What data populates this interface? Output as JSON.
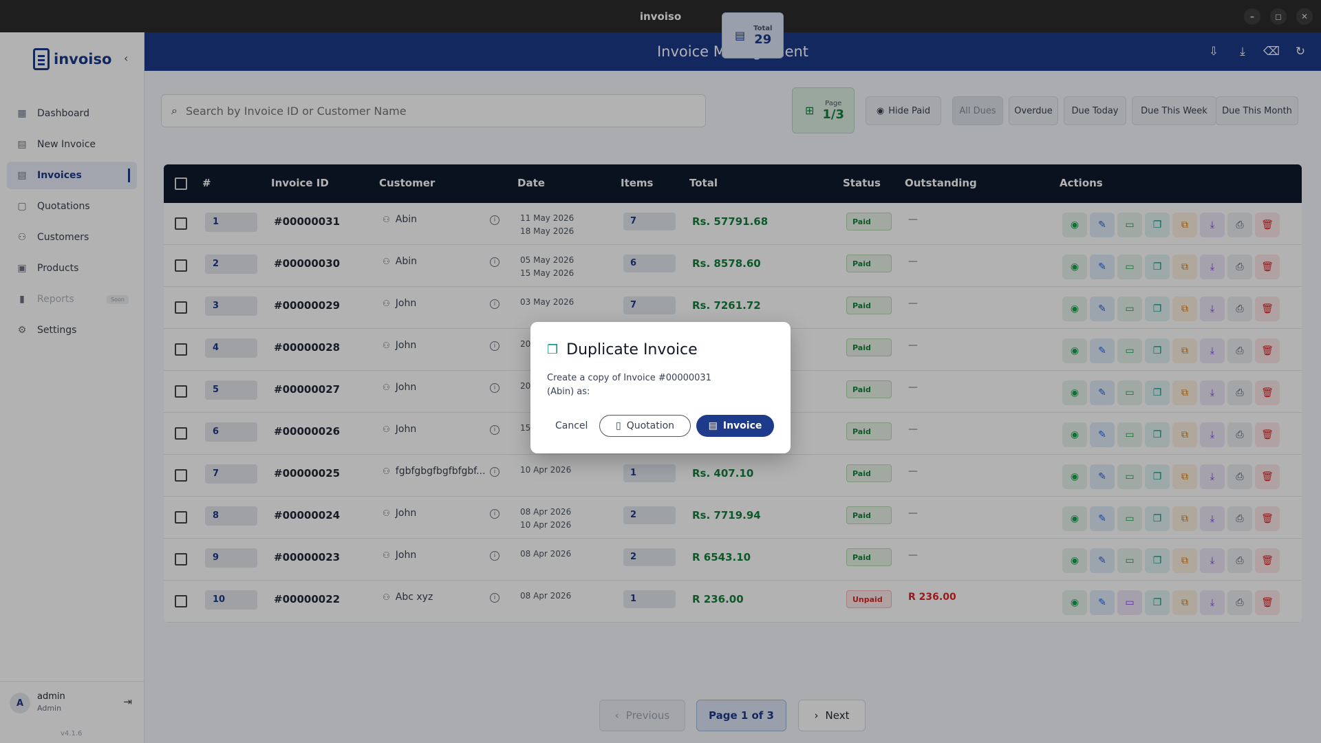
{
  "window": {
    "title": "invoiso",
    "minimize": "–",
    "restore": "◻",
    "close": "✕"
  },
  "brand": {
    "name": "invoiso",
    "collapse": "‹"
  },
  "nav": [
    {
      "label": "Dashboard",
      "icon": "dashboard-icon",
      "glyph": "▦"
    },
    {
      "label": "New Invoice",
      "icon": "new-invoice-icon",
      "glyph": "▤"
    },
    {
      "label": "Invoices",
      "icon": "invoices-icon",
      "glyph": "▤"
    },
    {
      "label": "Quotations",
      "icon": "quotations-icon",
      "glyph": "▢"
    },
    {
      "label": "Customers",
      "icon": "customers-icon",
      "glyph": "⚇"
    },
    {
      "label": "Products",
      "icon": "products-icon",
      "glyph": "▣"
    },
    {
      "label": "Reports",
      "icon": "reports-icon",
      "glyph": "▮",
      "badge": "Soon"
    },
    {
      "label": "Settings",
      "icon": "settings-icon",
      "glyph": "⚙"
    }
  ],
  "user": {
    "initial": "A",
    "name": "admin",
    "role": "Admin",
    "version": "v4.1.6"
  },
  "header": {
    "title": "Invoice Management"
  },
  "search": {
    "placeholder": "Search by Invoice ID or Customer Name"
  },
  "stats": {
    "total_label": "Total",
    "total_value": "29",
    "page_label": "Page",
    "page_value": "1/3"
  },
  "filters": {
    "hide_paid": "Hide Paid",
    "all_dues": "All Dues",
    "overdue": "Overdue",
    "due_today": "Due Today",
    "due_week": "Due This Week",
    "due_month": "Due This Month"
  },
  "columns": {
    "num": "#",
    "invoice_id": "Invoice ID",
    "customer": "Customer",
    "date": "Date",
    "items": "Items",
    "total": "Total",
    "status": "Status",
    "outstanding": "Outstanding",
    "actions": "Actions"
  },
  "rows": [
    {
      "n": "1",
      "id": "#00000031",
      "customer": "Abin",
      "date": "11 May 2026",
      "due": "18 May 2026",
      "items": "7",
      "total": "Rs. 57791.68",
      "status": "Paid",
      "outstanding": "—"
    },
    {
      "n": "2",
      "id": "#00000030",
      "customer": "Abin",
      "date": "05 May 2026",
      "due": "15 May 2026",
      "items": "6",
      "total": "Rs. 8578.60",
      "status": "Paid",
      "outstanding": "—"
    },
    {
      "n": "3",
      "id": "#00000029",
      "customer": "John",
      "date": "03 May 2026",
      "due": "",
      "items": "7",
      "total": "Rs. 7261.72",
      "status": "Paid",
      "outstanding": "—"
    },
    {
      "n": "4",
      "id": "#00000028",
      "customer": "John",
      "date": "20",
      "due": "",
      "items": "",
      "total": "",
      "status": "Paid",
      "outstanding": "—"
    },
    {
      "n": "5",
      "id": "#00000027",
      "customer": "John",
      "date": "20",
      "due": "",
      "items": "",
      "total": "",
      "status": "Paid",
      "outstanding": "—"
    },
    {
      "n": "6",
      "id": "#00000026",
      "customer": "John",
      "date": "15",
      "due": "",
      "items": "",
      "total": "",
      "status": "Paid",
      "outstanding": "—"
    },
    {
      "n": "7",
      "id": "#00000025",
      "customer": "fgbfgbgfbgfbfgbf...",
      "date": "10 Apr 2026",
      "due": "",
      "items": "1",
      "total": "Rs. 407.10",
      "status": "Paid",
      "outstanding": "—"
    },
    {
      "n": "8",
      "id": "#00000024",
      "customer": "John",
      "date": "08 Apr 2026",
      "due": "10 Apr 2026",
      "items": "2",
      "total": "Rs. 7719.94",
      "status": "Paid",
      "outstanding": "—"
    },
    {
      "n": "9",
      "id": "#00000023",
      "customer": "John",
      "date": "08 Apr 2026",
      "due": "",
      "items": "2",
      "total": "R 6543.10",
      "status": "Paid",
      "outstanding": "—"
    },
    {
      "n": "10",
      "id": "#00000022",
      "customer": "Abc xyz",
      "date": "08 Apr 2026",
      "due": "",
      "items": "1",
      "total": "R 236.00",
      "status": "Unpaid",
      "outstanding": "R 236.00"
    }
  ],
  "pagination": {
    "previous": "Previous",
    "current": "Page 1 of 3",
    "next": "Next"
  },
  "modal": {
    "title": "Duplicate Invoice",
    "text": "Create a copy of Invoice #00000031 (Abin) as:",
    "cancel": "Cancel",
    "quotation": "Quotation",
    "invoice": "Invoice"
  },
  "colors": {
    "brand": "#1e3a8a",
    "paid": "#15803d",
    "unpaid": "#dc2626",
    "table_header": "#0f1a2e"
  }
}
